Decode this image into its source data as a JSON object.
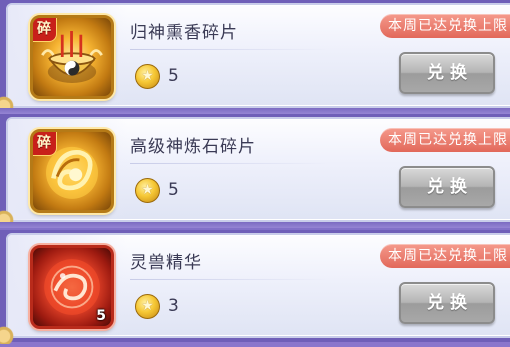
{
  "items": [
    {
      "name": "归神熏香碎片",
      "price": "5",
      "limit": "本周已达兑换上限",
      "button": "兑换",
      "fragment_tag": "碎",
      "count": ""
    },
    {
      "name": "高级神炼石碎片",
      "price": "5",
      "limit": "本周已达兑换上限",
      "button": "兑换",
      "fragment_tag": "碎",
      "count": ""
    },
    {
      "name": "灵兽精华",
      "price": "3",
      "limit": "本周已达兑换上限",
      "button": "兑换",
      "fragment_tag": "",
      "count": "5"
    }
  ],
  "colors": {
    "limit_badge": "#e2685a",
    "button_disabled": "#a8a8a8",
    "card_bg": "#eef0fb",
    "gold_frame": "#b57a17",
    "red_frame": "#b92b1b"
  },
  "icons": [
    "incense-burner-icon",
    "spirit-stone-icon",
    "beast-essence-icon",
    "coin-icon"
  ]
}
